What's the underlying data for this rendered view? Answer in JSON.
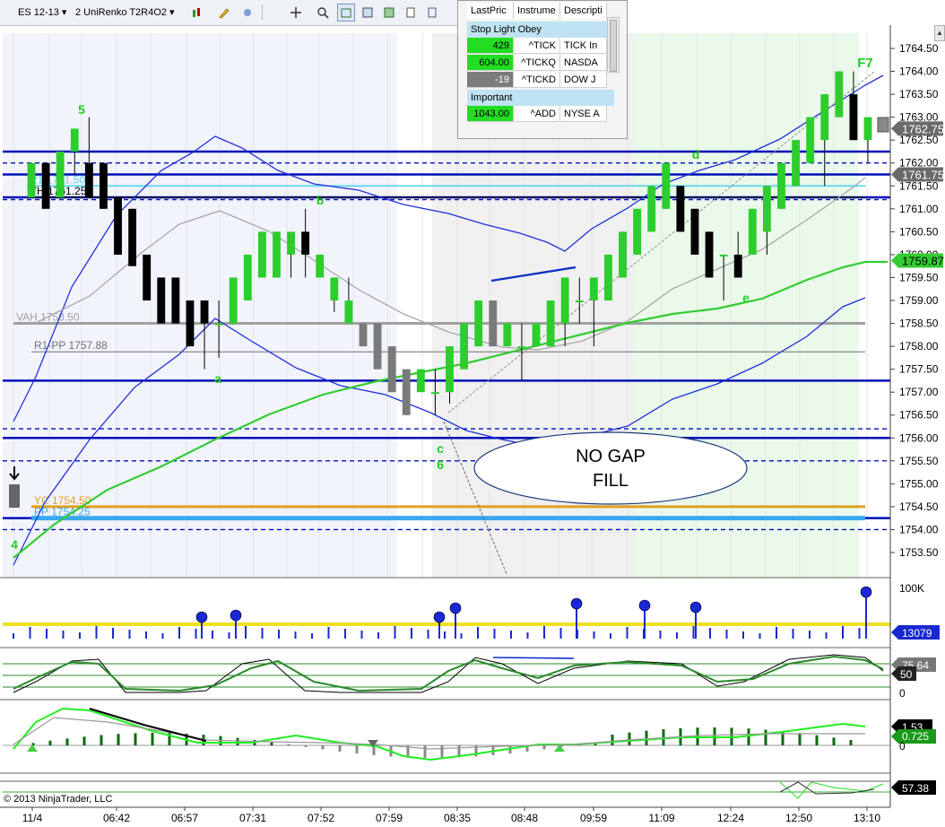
{
  "toolbar": {
    "instrument": "ES 12-13",
    "period": "2 UniRenko T2R4O2",
    "icons": [
      "bar-style-icon",
      "pencil-draw-icon",
      "marker-icon",
      "crosshair-icon",
      "zoom-icon",
      "data-box-icon",
      "properties-icon",
      "chart-trader-icon",
      "new-window-icon"
    ]
  },
  "market_watch": {
    "columns": [
      "LastPric",
      "Instrume",
      "Descripti"
    ],
    "groups": [
      {
        "name": "Stop Light Obey",
        "rows": [
          {
            "last": "429",
            "instrument": "^TICK",
            "description": "TICK In",
            "color": "#22dd22"
          },
          {
            "last": "604.00",
            "instrument": "^TICKQ",
            "description": "NASDA",
            "color": "#22dd22"
          },
          {
            "last": "-19",
            "instrument": "^TICKD",
            "description": "DOW J",
            "color": "#7c7c7c"
          }
        ]
      },
      {
        "name": "Important",
        "rows": [
          {
            "last": "1043.00",
            "instrument": "^ADD",
            "description": "NYSE A",
            "color": "#22dd22"
          }
        ]
      }
    ]
  },
  "price_axis": {
    "ticks": [
      "1764.50",
      "1764.00",
      "1763.50",
      "1763.00",
      "1762.50",
      "1762.00",
      "1761.50",
      "1761.00",
      "1760.50",
      "1760.00",
      "1759.50",
      "1759.00",
      "1758.50",
      "1758.00",
      "1757.50",
      "1757.00",
      "1756.50",
      "1756.00",
      "1755.50",
      "1755.00",
      "1754.50",
      "1754.00",
      "1753.50"
    ],
    "markers": [
      {
        "label": "1762.75",
        "value": 1762.75,
        "bg": "#6a6a6a",
        "fg": "#ffffff"
      },
      {
        "label": "1761.75",
        "value": 1761.75,
        "bg": "#6a6a6a",
        "fg": "#ffffff"
      },
      {
        "label": "1759.87",
        "value": 1759.87,
        "bg": "#33cc33",
        "fg": "#000000"
      }
    ]
  },
  "time_axis": [
    "11/4",
    "06:42",
    "06:57",
    "07:31",
    "07:52",
    "07:59",
    "08:35",
    "08:48",
    "09:59",
    "11:09",
    "12:24",
    "12:50",
    "13:10"
  ],
  "levels": [
    {
      "label": "R1 1761.50",
      "value": 1761.5,
      "color": "#5dd5f0"
    },
    {
      "label": "YH 1761.25",
      "value": 1761.25,
      "color": "#000000"
    },
    {
      "label": "VAH 1758.50",
      "value": 1758.5,
      "color": "#a0a0a0"
    },
    {
      "label": "R1-PP 1757.88",
      "value": 1757.88,
      "color": "#707070"
    },
    {
      "label": "YC 1754.50",
      "value": 1754.5,
      "color": "#e0a020"
    },
    {
      "label": "PP 1754.25",
      "value": 1754.25,
      "color": "#3aa8f0"
    }
  ],
  "annotations": {
    "swing_labels": [
      "5",
      "b",
      "a",
      "c",
      "6",
      "d",
      "e",
      "F7",
      "4"
    ],
    "callout": "NO GAP\nFILL",
    "callout_line1": "NO GAP",
    "callout_line2": "FILL"
  },
  "panels": {
    "volume": {
      "labels": [
        "100K",
        "13079"
      ],
      "current": "13079"
    },
    "stochastics": {
      "labels": [
        "75.64",
        "50",
        "0"
      ],
      "current": "75.64"
    },
    "macd": {
      "labels": [
        "1.53",
        "0.725",
        "0"
      ],
      "current": "1.53"
    },
    "adx": {
      "labels": [
        "57.38"
      ],
      "current": "57.38"
    }
  },
  "copyright": "© 2013 NinjaTrader, LLC",
  "chart_data": {
    "type": "candlestick",
    "instrument": "ES 12-13",
    "bars": [
      [
        1761.25,
        1762.0,
        1761.25,
        1762.0
      ],
      [
        1762.0,
        1762.0,
        1761.0,
        1761.0
      ],
      [
        1761.25,
        1762.25,
        1761.25,
        1762.25
      ],
      [
        1762.25,
        1762.75,
        1761.75,
        1762.75
      ],
      [
        1762.0,
        1763.0,
        1761.25,
        1761.25
      ],
      [
        1762.0,
        1762.0,
        1761.0,
        1761.0
      ],
      [
        1761.25,
        1761.25,
        1760.0,
        1760.0
      ],
      [
        1761.0,
        1761.0,
        1759.75,
        1759.75
      ],
      [
        1760.0,
        1760.0,
        1759.0,
        1759.0
      ],
      [
        1759.5,
        1759.5,
        1758.5,
        1758.5
      ],
      [
        1759.5,
        1759.5,
        1758.5,
        1758.5
      ],
      [
        1759.0,
        1759.0,
        1758.0,
        1758.0
      ],
      [
        1759.0,
        1759.0,
        1757.5,
        1758.5
      ],
      [
        1758.5,
        1759.0,
        1757.75,
        1758.5
      ],
      [
        1758.5,
        1759.5,
        1758.5,
        1759.5
      ],
      [
        1759.0,
        1760.0,
        1759.0,
        1760.0
      ],
      [
        1759.5,
        1760.5,
        1759.5,
        1760.5
      ],
      [
        1759.5,
        1760.5,
        1759.5,
        1760.5
      ],
      [
        1760.0,
        1760.5,
        1759.5,
        1760.5
      ],
      [
        1760.5,
        1761.0,
        1759.5,
        1760.0
      ],
      [
        1759.5,
        1760.0,
        1759.5,
        1760.0
      ],
      [
        1759.0,
        1759.5,
        1758.75,
        1759.5
      ],
      [
        1758.5,
        1759.5,
        1758.5,
        1759.0
      ],
      [
        1758.5,
        1758.5,
        1758.0,
        1758.0
      ],
      [
        1758.5,
        1758.5,
        1757.5,
        1757.5
      ],
      [
        1758.0,
        1758.0,
        1757.0,
        1757.0
      ],
      [
        1757.5,
        1757.5,
        1756.5,
        1756.5
      ],
      [
        1757.0,
        1757.5,
        1757.0,
        1757.5
      ],
      [
        1757.0,
        1757.5,
        1756.5,
        1757.0
      ],
      [
        1757.0,
        1758.0,
        1756.75,
        1758.0
      ],
      [
        1757.5,
        1758.5,
        1757.5,
        1758.5
      ],
      [
        1758.0,
        1759.0,
        1758.0,
        1759.0
      ],
      [
        1759.0,
        1759.0,
        1758.0,
        1758.0
      ],
      [
        1758.0,
        1758.5,
        1758.0,
        1758.5
      ],
      [
        1758.0,
        1758.5,
        1757.25,
        1758.0
      ],
      [
        1758.0,
        1758.5,
        1758.0,
        1758.5
      ],
      [
        1758.0,
        1759.0,
        1758.0,
        1759.0
      ],
      [
        1758.5,
        1759.5,
        1758.0,
        1759.5
      ],
      [
        1759.0,
        1759.5,
        1758.5,
        1759.0
      ],
      [
        1759.0,
        1759.5,
        1758.0,
        1759.5
      ],
      [
        1759.0,
        1760.0,
        1759.0,
        1760.0
      ],
      [
        1759.5,
        1760.5,
        1759.5,
        1760.5
      ],
      [
        1760.0,
        1761.0,
        1760.0,
        1761.0
      ],
      [
        1760.5,
        1761.5,
        1760.5,
        1761.5
      ],
      [
        1761.0,
        1762.0,
        1761.0,
        1762.0
      ],
      [
        1761.5,
        1761.5,
        1760.5,
        1760.5
      ],
      [
        1761.0,
        1761.0,
        1760.0,
        1760.0
      ],
      [
        1760.5,
        1760.5,
        1759.5,
        1759.5
      ],
      [
        1760.0,
        1760.0,
        1759.0,
        1760.0
      ],
      [
        1760.0,
        1760.5,
        1759.5,
        1759.5
      ],
      [
        1760.0,
        1761.0,
        1760.0,
        1761.0
      ],
      [
        1760.5,
        1761.5,
        1760.0,
        1761.5
      ],
      [
        1761.0,
        1762.0,
        1761.0,
        1762.0
      ],
      [
        1761.5,
        1762.5,
        1761.5,
        1762.5
      ],
      [
        1762.0,
        1763.0,
        1762.0,
        1763.0
      ],
      [
        1762.5,
        1763.5,
        1761.5,
        1763.5
      ],
      [
        1763.0,
        1764.0,
        1763.0,
        1764.0
      ],
      [
        1763.5,
        1764.0,
        1762.5,
        1762.5
      ],
      [
        1762.5,
        1763.0,
        1762.0,
        1763.0
      ]
    ],
    "bar_fields": [
      "open",
      "high",
      "low",
      "close"
    ],
    "ylim": [
      1753.2,
      1765.0
    ]
  }
}
